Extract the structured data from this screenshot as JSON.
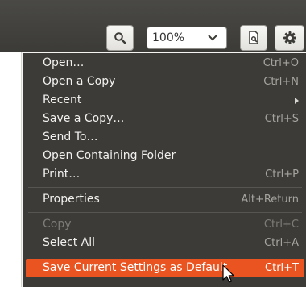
{
  "toolbar": {
    "zoom_value": "100%",
    "search_icon": "search-icon",
    "document_icon": "document-properties-icon",
    "gear_icon": "gear-icon"
  },
  "menu": {
    "items": [
      {
        "label": "Open…",
        "accel": "Ctrl+O"
      },
      {
        "label": "Open a Copy",
        "accel": "Ctrl+N"
      },
      {
        "label": "Recent",
        "accel": ""
      },
      {
        "label": "Save a Copy…",
        "accel": "Ctrl+S"
      },
      {
        "label": "Send To…",
        "accel": ""
      },
      {
        "label": "Open Containing Folder",
        "accel": ""
      },
      {
        "label": "Print…",
        "accel": "Ctrl+P"
      },
      {
        "label": "Properties",
        "accel": "Alt+Return"
      },
      {
        "label": "Copy",
        "accel": "Ctrl+C"
      },
      {
        "label": "Select All",
        "accel": "Ctrl+A"
      },
      {
        "label": "Save Current Settings as Default",
        "accel": "Ctrl+T"
      }
    ]
  },
  "colors": {
    "menu_background": "#3c3b37",
    "highlight": "#e95420",
    "text": "#f2f1f0"
  }
}
